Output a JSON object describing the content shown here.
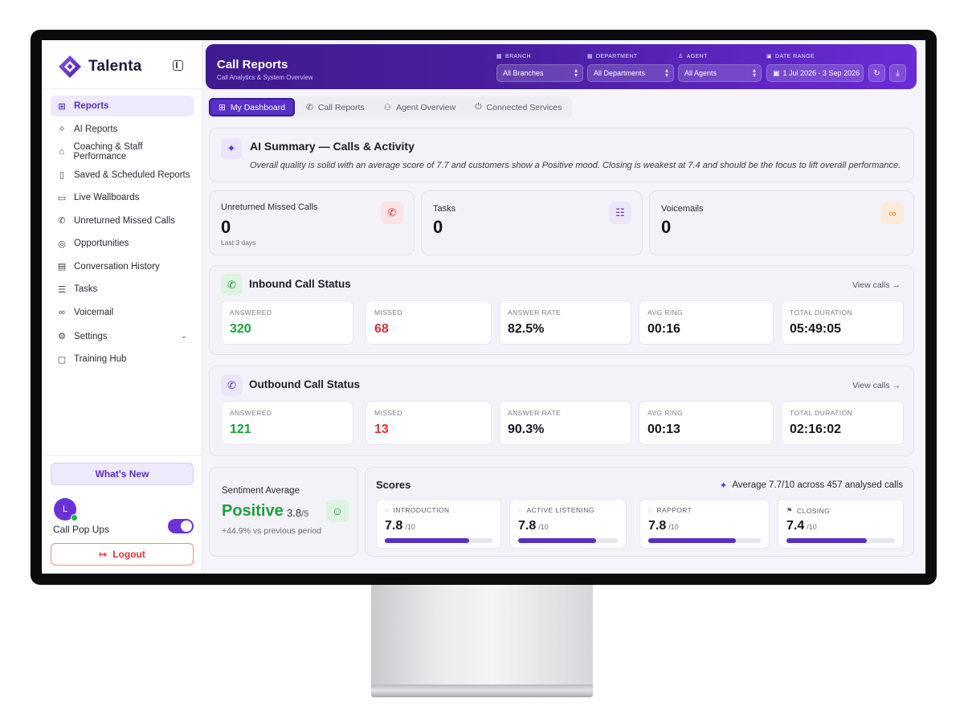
{
  "app": {
    "name": "Talenta"
  },
  "sidebar": {
    "items": [
      {
        "label": "Reports",
        "icon": "grid-icon",
        "glyph": "⊞",
        "active": true
      },
      {
        "label": "AI Reports",
        "icon": "sparkles-icon",
        "glyph": "✧"
      },
      {
        "label": "Coaching & Staff Performance",
        "icon": "graduation-cap-icon",
        "glyph": "⌂"
      },
      {
        "label": "Saved & Scheduled Reports",
        "icon": "bookmark-icon",
        "glyph": "▯"
      },
      {
        "label": "Live Wallboards",
        "icon": "monitor-icon",
        "glyph": "▭"
      },
      {
        "label": "Unreturned Missed Calls",
        "icon": "phone-missed-icon",
        "glyph": "✆"
      },
      {
        "label": "Opportunities",
        "icon": "target-icon",
        "glyph": "◎"
      },
      {
        "label": "Conversation History",
        "icon": "message-icon",
        "glyph": "▤"
      },
      {
        "label": "Tasks",
        "icon": "list-checks-icon",
        "glyph": "☰"
      },
      {
        "label": "Voicemail",
        "icon": "voicemail-icon",
        "glyph": "∞"
      },
      {
        "label": "Settings",
        "icon": "gear-icon",
        "glyph": "⚙",
        "has_chevron": true
      },
      {
        "label": "Training Hub",
        "icon": "presentation-icon",
        "glyph": "▢"
      }
    ],
    "whats_new": "What's New",
    "user_initial": "L",
    "call_popups_label": "Call Pop Ups",
    "call_popups_on": true,
    "logout": "Logout"
  },
  "header": {
    "title": "Call Reports",
    "subtitle": "Call Analytics & System Overview",
    "filters": {
      "branch": {
        "label": "BRANCH",
        "value": "All Branches"
      },
      "department": {
        "label": "DEPARTMENT",
        "value": "All Departments"
      },
      "agent": {
        "label": "AGENT",
        "value": "All Agents"
      },
      "date_range": {
        "label": "DATE RANGE",
        "value": "1 Jul 2026 - 3 Sep 2026"
      }
    }
  },
  "tabs": [
    {
      "label": "My Dashboard",
      "active": true
    },
    {
      "label": "Call Reports"
    },
    {
      "label": "Agent Overview"
    },
    {
      "label": "Connected Services"
    }
  ],
  "ai_summary": {
    "title": "AI Summary — Calls & Activity",
    "text": "Overall quality is solid with an average score of 7.7 and customers show a Positive mood. Closing is weakest at 7.4 and should be the focus to lift overall performance."
  },
  "stats": {
    "missed": {
      "label": "Unreturned Missed Calls",
      "value": "0",
      "note": "Last 3 days"
    },
    "tasks": {
      "label": "Tasks",
      "value": "0"
    },
    "voicemails": {
      "label": "Voicemails",
      "value": "0"
    }
  },
  "inbound": {
    "title": "Inbound Call Status",
    "link": "View calls →",
    "metrics": [
      {
        "label": "ANSWERED",
        "value": "320",
        "color": "#1e9e3d"
      },
      {
        "label": "MISSED",
        "value": "68",
        "color": "#e0303a"
      },
      {
        "label": "ANSWER RATE",
        "value": "82.5%",
        "color": "#15151e"
      },
      {
        "label": "AVG RING",
        "value": "00:16",
        "color": "#15151e"
      },
      {
        "label": "TOTAL DURATION",
        "value": "05:49:05",
        "color": "#15151e"
      }
    ]
  },
  "outbound": {
    "title": "Outbound Call Status",
    "link": "View calls →",
    "metrics": [
      {
        "label": "ANSWERED",
        "value": "121",
        "color": "#1e9e3d"
      },
      {
        "label": "MISSED",
        "value": "13",
        "color": "#e0303a"
      },
      {
        "label": "ANSWER RATE",
        "value": "90.3%",
        "color": "#15151e"
      },
      {
        "label": "AVG RING",
        "value": "00:13",
        "color": "#15151e"
      },
      {
        "label": "TOTAL DURATION",
        "value": "02:16:02",
        "color": "#15151e"
      }
    ]
  },
  "sentiment": {
    "label": "Sentiment Average",
    "value": "Positive",
    "score": "3.8",
    "score_max": "/5",
    "change": "+44.9% vs previous period"
  },
  "scores": {
    "title": "Scores",
    "average_text": "Average 7.7/10 across 457 analysed calls",
    "items": [
      {
        "label": "INTRODUCTION",
        "value": "7.8",
        "max": "/10",
        "fraction": 0.78
      },
      {
        "label": "ACTIVE LISTENING",
        "value": "7.8",
        "max": "/10",
        "fraction": 0.78
      },
      {
        "label": "RAPPORT",
        "value": "7.8",
        "max": "/10",
        "fraction": 0.78
      },
      {
        "label": "CLOSING",
        "value": "7.4",
        "max": "/10",
        "fraction": 0.74
      }
    ]
  },
  "colors": {
    "accent": "#5a2fc7",
    "positive": "#1e9e3d",
    "negative": "#e0303a"
  }
}
